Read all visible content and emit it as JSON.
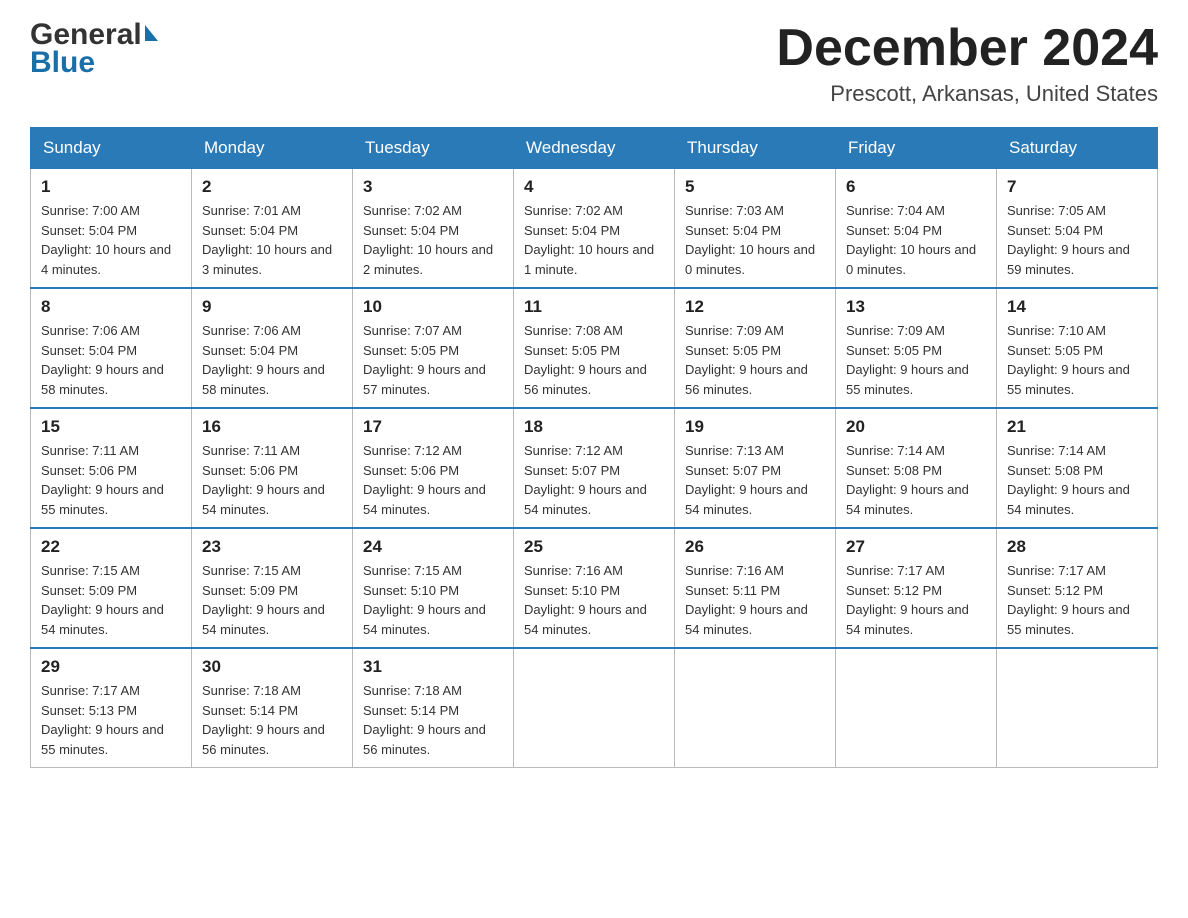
{
  "header": {
    "logo_general": "General",
    "logo_blue": "Blue",
    "title": "December 2024",
    "subtitle": "Prescott, Arkansas, United States"
  },
  "days_of_week": [
    "Sunday",
    "Monday",
    "Tuesday",
    "Wednesday",
    "Thursday",
    "Friday",
    "Saturday"
  ],
  "weeks": [
    [
      {
        "day": "1",
        "sunrise": "7:00 AM",
        "sunset": "5:04 PM",
        "daylight": "10 hours and 4 minutes."
      },
      {
        "day": "2",
        "sunrise": "7:01 AM",
        "sunset": "5:04 PM",
        "daylight": "10 hours and 3 minutes."
      },
      {
        "day": "3",
        "sunrise": "7:02 AM",
        "sunset": "5:04 PM",
        "daylight": "10 hours and 2 minutes."
      },
      {
        "day": "4",
        "sunrise": "7:02 AM",
        "sunset": "5:04 PM",
        "daylight": "10 hours and 1 minute."
      },
      {
        "day": "5",
        "sunrise": "7:03 AM",
        "sunset": "5:04 PM",
        "daylight": "10 hours and 0 minutes."
      },
      {
        "day": "6",
        "sunrise": "7:04 AM",
        "sunset": "5:04 PM",
        "daylight": "10 hours and 0 minutes."
      },
      {
        "day": "7",
        "sunrise": "7:05 AM",
        "sunset": "5:04 PM",
        "daylight": "9 hours and 59 minutes."
      }
    ],
    [
      {
        "day": "8",
        "sunrise": "7:06 AM",
        "sunset": "5:04 PM",
        "daylight": "9 hours and 58 minutes."
      },
      {
        "day": "9",
        "sunrise": "7:06 AM",
        "sunset": "5:04 PM",
        "daylight": "9 hours and 58 minutes."
      },
      {
        "day": "10",
        "sunrise": "7:07 AM",
        "sunset": "5:05 PM",
        "daylight": "9 hours and 57 minutes."
      },
      {
        "day": "11",
        "sunrise": "7:08 AM",
        "sunset": "5:05 PM",
        "daylight": "9 hours and 56 minutes."
      },
      {
        "day": "12",
        "sunrise": "7:09 AM",
        "sunset": "5:05 PM",
        "daylight": "9 hours and 56 minutes."
      },
      {
        "day": "13",
        "sunrise": "7:09 AM",
        "sunset": "5:05 PM",
        "daylight": "9 hours and 55 minutes."
      },
      {
        "day": "14",
        "sunrise": "7:10 AM",
        "sunset": "5:05 PM",
        "daylight": "9 hours and 55 minutes."
      }
    ],
    [
      {
        "day": "15",
        "sunrise": "7:11 AM",
        "sunset": "5:06 PM",
        "daylight": "9 hours and 55 minutes."
      },
      {
        "day": "16",
        "sunrise": "7:11 AM",
        "sunset": "5:06 PM",
        "daylight": "9 hours and 54 minutes."
      },
      {
        "day": "17",
        "sunrise": "7:12 AM",
        "sunset": "5:06 PM",
        "daylight": "9 hours and 54 minutes."
      },
      {
        "day": "18",
        "sunrise": "7:12 AM",
        "sunset": "5:07 PM",
        "daylight": "9 hours and 54 minutes."
      },
      {
        "day": "19",
        "sunrise": "7:13 AM",
        "sunset": "5:07 PM",
        "daylight": "9 hours and 54 minutes."
      },
      {
        "day": "20",
        "sunrise": "7:14 AM",
        "sunset": "5:08 PM",
        "daylight": "9 hours and 54 minutes."
      },
      {
        "day": "21",
        "sunrise": "7:14 AM",
        "sunset": "5:08 PM",
        "daylight": "9 hours and 54 minutes."
      }
    ],
    [
      {
        "day": "22",
        "sunrise": "7:15 AM",
        "sunset": "5:09 PM",
        "daylight": "9 hours and 54 minutes."
      },
      {
        "day": "23",
        "sunrise": "7:15 AM",
        "sunset": "5:09 PM",
        "daylight": "9 hours and 54 minutes."
      },
      {
        "day": "24",
        "sunrise": "7:15 AM",
        "sunset": "5:10 PM",
        "daylight": "9 hours and 54 minutes."
      },
      {
        "day": "25",
        "sunrise": "7:16 AM",
        "sunset": "5:10 PM",
        "daylight": "9 hours and 54 minutes."
      },
      {
        "day": "26",
        "sunrise": "7:16 AM",
        "sunset": "5:11 PM",
        "daylight": "9 hours and 54 minutes."
      },
      {
        "day": "27",
        "sunrise": "7:17 AM",
        "sunset": "5:12 PM",
        "daylight": "9 hours and 54 minutes."
      },
      {
        "day": "28",
        "sunrise": "7:17 AM",
        "sunset": "5:12 PM",
        "daylight": "9 hours and 55 minutes."
      }
    ],
    [
      {
        "day": "29",
        "sunrise": "7:17 AM",
        "sunset": "5:13 PM",
        "daylight": "9 hours and 55 minutes."
      },
      {
        "day": "30",
        "sunrise": "7:18 AM",
        "sunset": "5:14 PM",
        "daylight": "9 hours and 56 minutes."
      },
      {
        "day": "31",
        "sunrise": "7:18 AM",
        "sunset": "5:14 PM",
        "daylight": "9 hours and 56 minutes."
      },
      null,
      null,
      null,
      null
    ]
  ]
}
